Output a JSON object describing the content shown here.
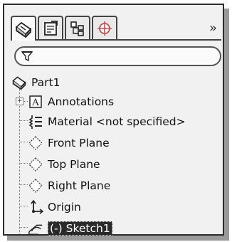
{
  "tabs": [
    {
      "icon": "feature-manager-icon",
      "active": true
    },
    {
      "icon": "property-manager-icon",
      "active": false
    },
    {
      "icon": "configuration-manager-icon",
      "active": false
    },
    {
      "icon": "dimxpert-manager-icon",
      "active": false
    }
  ],
  "overflow_label": "»",
  "filter": {
    "icon": "filter-icon",
    "value": ""
  },
  "tree": {
    "root": {
      "label": "Part1",
      "icon": "part-icon"
    },
    "items": [
      {
        "label": "Annotations",
        "icon": "annotations-icon",
        "expandable": true
      },
      {
        "label": "Material <not specified>",
        "icon": "material-icon"
      },
      {
        "label": "Front Plane",
        "icon": "plane-icon"
      },
      {
        "label": "Top Plane",
        "icon": "plane-icon"
      },
      {
        "label": "Right Plane",
        "icon": "plane-icon"
      },
      {
        "label": "Origin",
        "icon": "origin-icon"
      },
      {
        "label": "(-) Sketch1",
        "icon": "sketch-icon",
        "selected": true
      }
    ]
  }
}
